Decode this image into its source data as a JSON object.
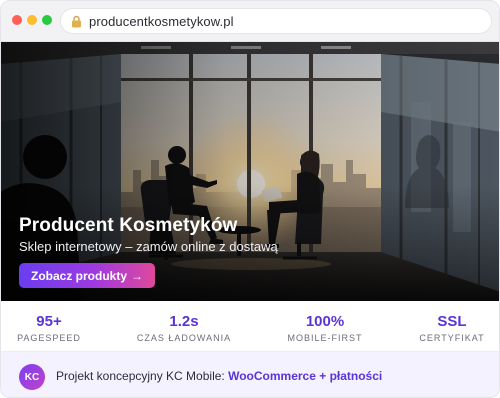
{
  "browser": {
    "url": "producentkosmetykow.pl"
  },
  "hero": {
    "title": "Producent Kosmetyków",
    "subtitle": "Sklep internetowy – zamów online z dostawą",
    "cta_label": "Zobacz produkty",
    "cta_arrow": "→"
  },
  "stats": [
    {
      "value": "95+",
      "label": "PAGESPEED"
    },
    {
      "value": "1.2s",
      "label": "CZAS ŁADOWANIA"
    },
    {
      "value": "100%",
      "label": "MOBILE-FIRST"
    },
    {
      "value": "SSL",
      "label": "CERTYFIKAT"
    }
  ],
  "footer": {
    "badge": "KC",
    "text": "Projekt koncepcyjny KC Mobile:",
    "link": "WooCommerce + płatności"
  },
  "colors": {
    "accent": "#5b34d6",
    "cta_start": "#6a3df0",
    "cta_end": "#e0489c",
    "footer_bg": "#f4f2ff"
  }
}
